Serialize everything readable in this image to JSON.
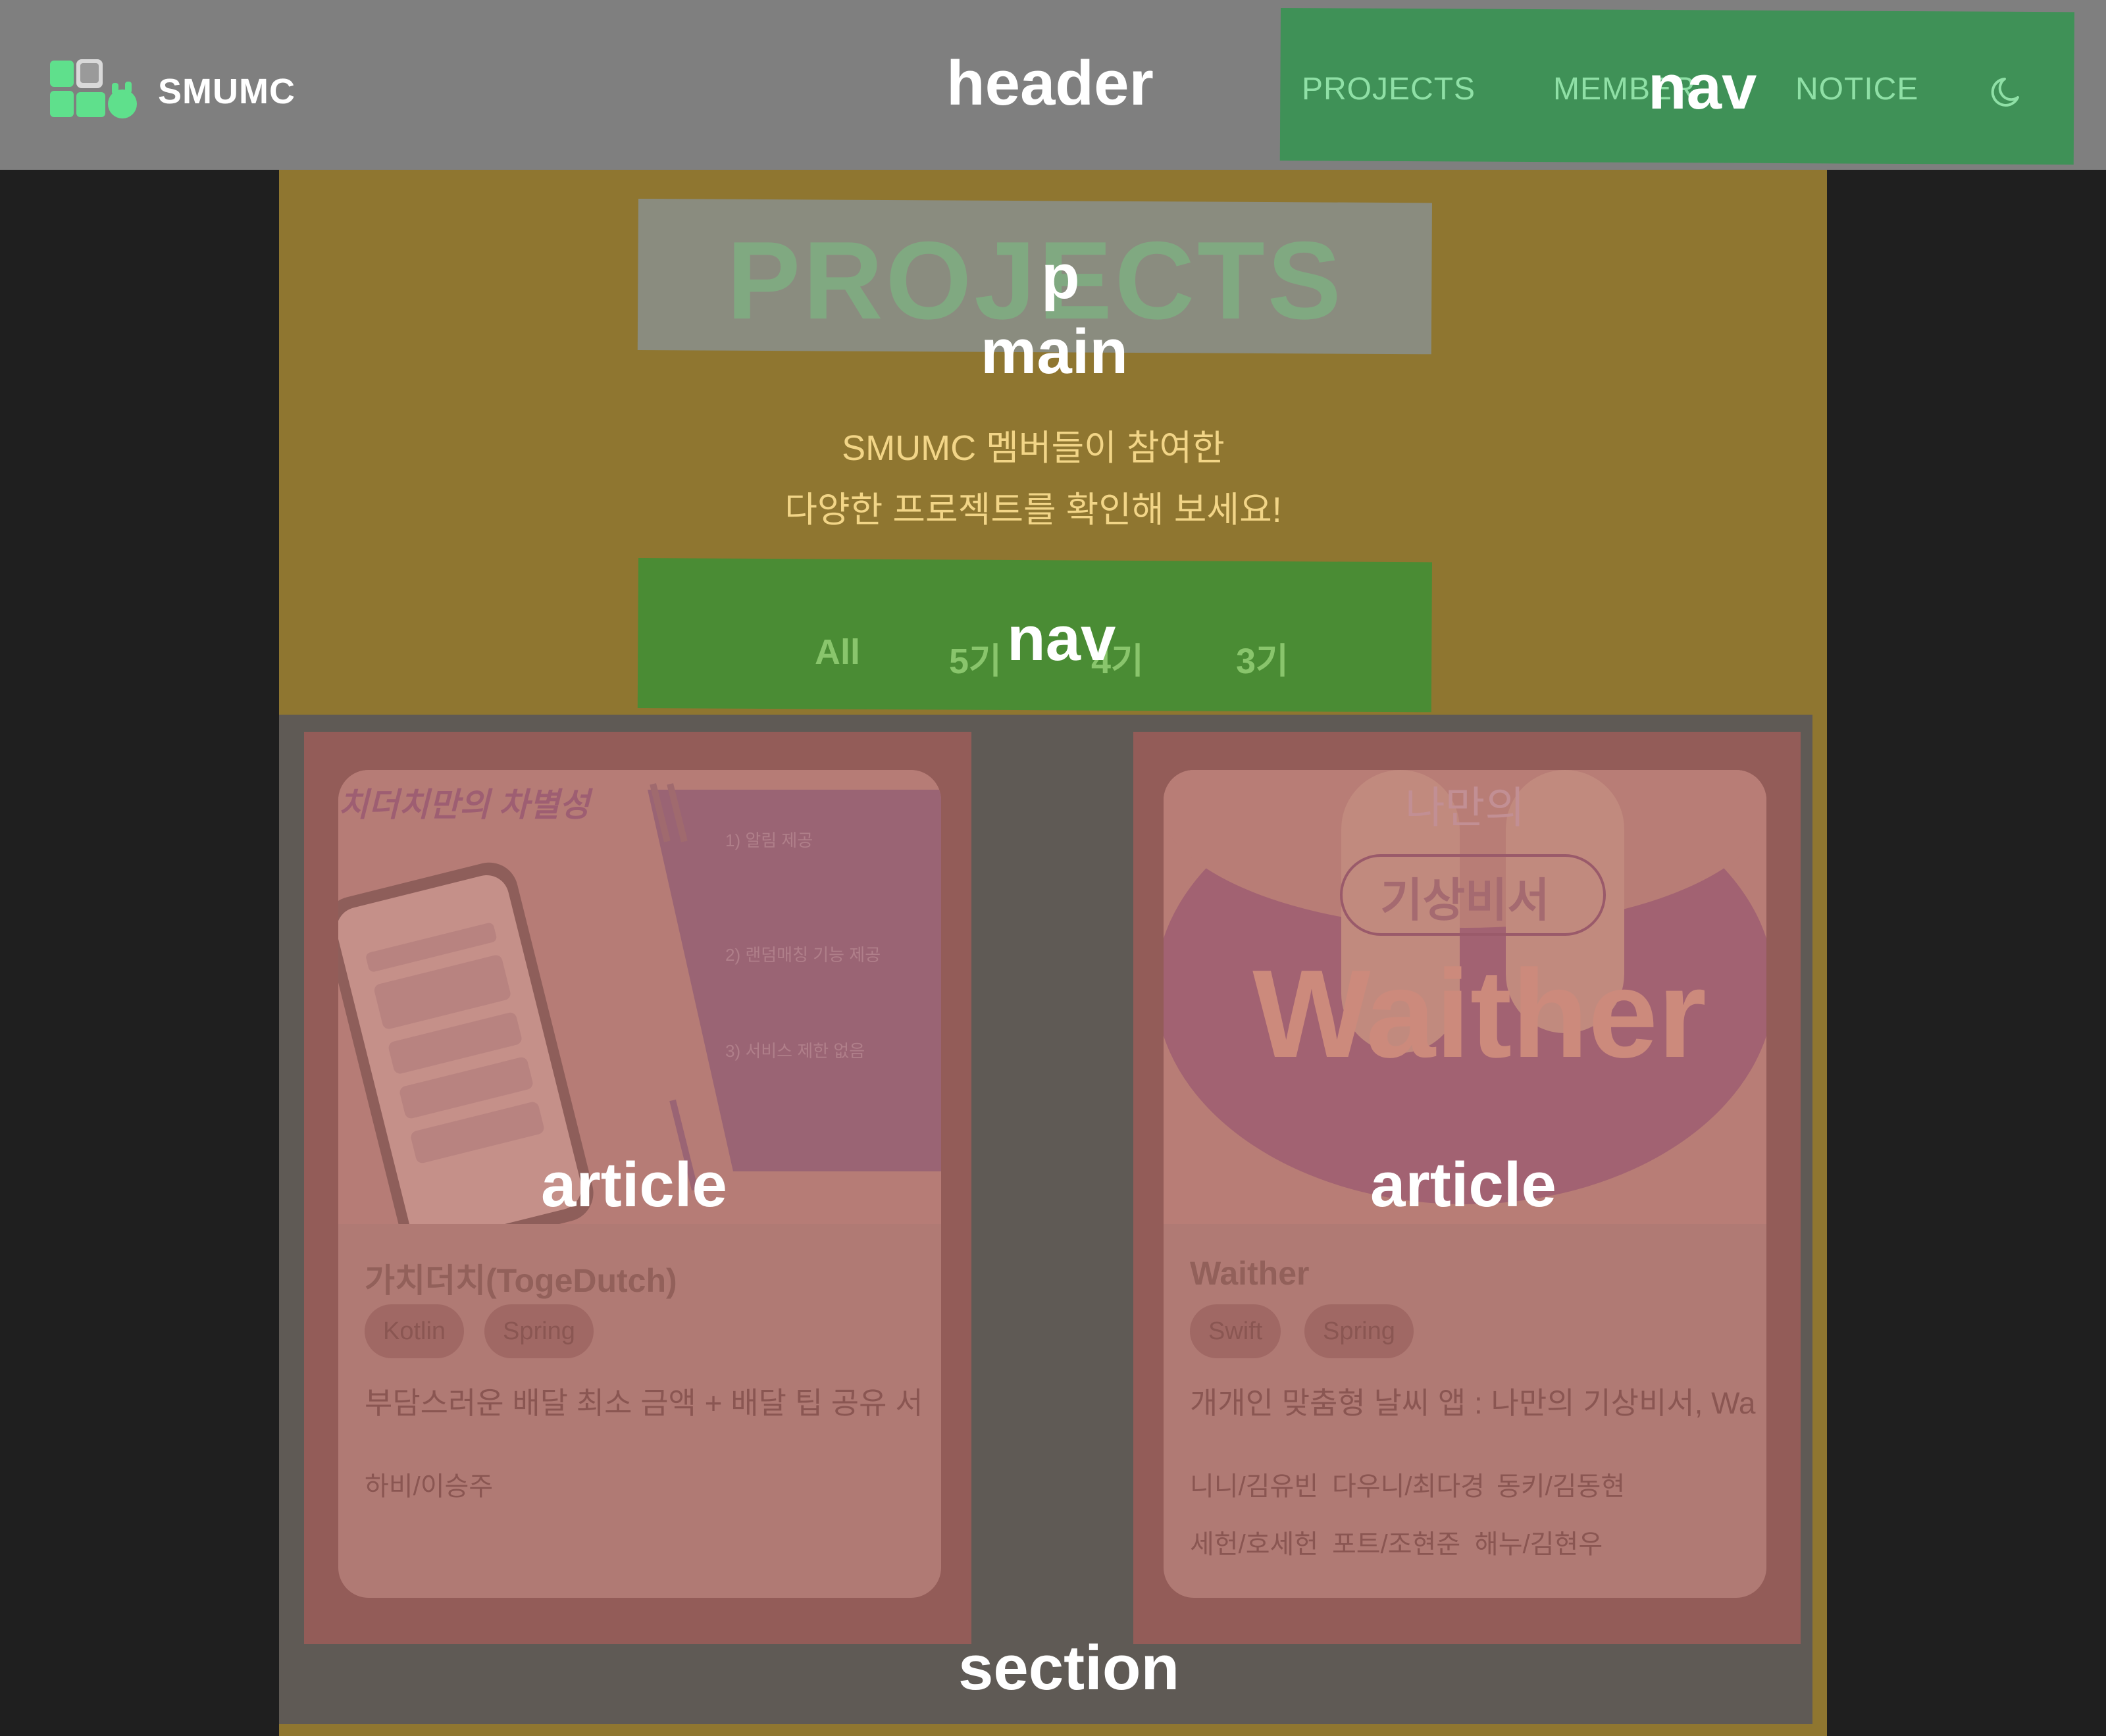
{
  "header": {
    "brand": "SMUMC",
    "overlay_label": "header"
  },
  "top_nav": {
    "overlay_label": "nav",
    "items": [
      "PROJECTS",
      "MEMBER",
      "NOTICE"
    ],
    "theme_icon": "moon-icon"
  },
  "main": {
    "overlay_title_label": "p",
    "overlay_label": "main",
    "title": "PROJECTS",
    "subtitle_line1": "SMUMC 멤버들이 참여한",
    "subtitle_line2": "다양한 프로젝트를 확인해 보세요!"
  },
  "filter_nav": {
    "overlay_label": "nav",
    "items": [
      "All",
      "5기",
      "4기",
      "3기"
    ]
  },
  "section": {
    "overlay_label": "section",
    "articles": [
      {
        "overlay_label": "article",
        "thumb_headline": "치더치만의 차별성",
        "thumb_points": [
          "1) 알림 제공",
          "2) 랜덤매칭 기능 제공",
          "3) 서비스 제한 없음"
        ],
        "title": "가치더치(TogeDutch)",
        "tags": [
          "Kotlin",
          "Spring"
        ],
        "description": "부담스러운 배달 최소 금액 + 배달 팁 공유 서",
        "members": [
          "하비/이승주"
        ]
      },
      {
        "overlay_label": "article",
        "thumb_line1": "나만의",
        "thumb_line2": "기상비서",
        "thumb_logo": "Waither",
        "title": "Waither",
        "tags": [
          "Swift",
          "Spring"
        ],
        "description": "개개인 맞춤형 날씨 앱 : 나만의 기상비서, Wa",
        "members": [
          "니니/김유빈",
          "다우니/최다경",
          "동키/김동현",
          "세헌/호세헌",
          "포트/조현준",
          "해누/김현우"
        ]
      }
    ]
  },
  "colors": {
    "header_bg": "#7f7f7f",
    "nav_bg": "#3f9157",
    "main_bg": "#8f7630",
    "section_bg": "#5f5a55",
    "article_bg": "#935c58",
    "card_bg": "#b07a74",
    "page_bg": "#1f1f1f"
  }
}
